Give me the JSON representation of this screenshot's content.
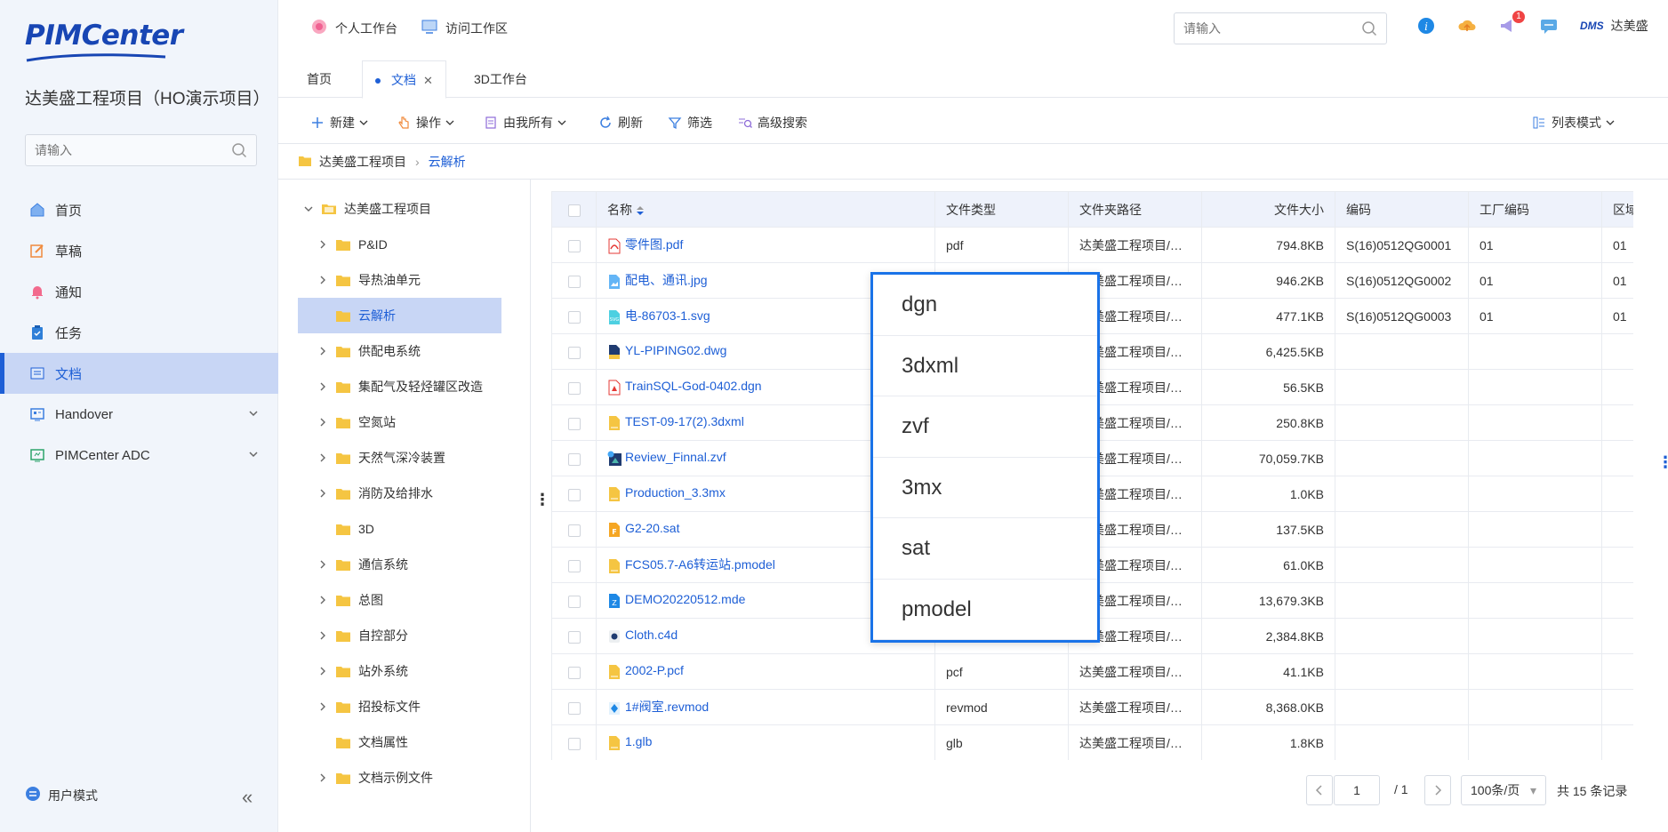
{
  "app": {
    "logo": "PIMCenter",
    "project_title": "达美盛工程项目（HO演示项目）"
  },
  "sidebar": {
    "search_placeholder": "请输入",
    "items": [
      {
        "label": "首页",
        "icon": "home-icon"
      },
      {
        "label": "草稿",
        "icon": "edit-icon"
      },
      {
        "label": "通知",
        "icon": "bell-icon"
      },
      {
        "label": "任务",
        "icon": "clipboard-icon"
      },
      {
        "label": "文档",
        "icon": "document-icon"
      },
      {
        "label": "Handover",
        "icon": "handover-icon"
      },
      {
        "label": "PIMCenter ADC",
        "icon": "adc-icon"
      }
    ],
    "user_mode": "用户模式"
  },
  "topbar": {
    "personal_workspace": "个人工作台",
    "visit_workspace": "访问工作区",
    "search_placeholder": "请输入",
    "notification_count": "1",
    "dms_label": "DMS",
    "user_name": "达美盛"
  },
  "tabs": [
    "首页",
    "文档",
    "3D工作台"
  ],
  "toolbar": {
    "new": "新建",
    "operate": "操作",
    "owned_by_me": "由我所有",
    "refresh": "刷新",
    "filter": "筛选",
    "advanced_search": "高级搜索",
    "view_mode": "列表模式"
  },
  "breadcrumb": {
    "root": "达美盛工程项目",
    "current": "云解析"
  },
  "tree": {
    "root": "达美盛工程项目",
    "children": [
      {
        "label": "P&ID",
        "expandable": true
      },
      {
        "label": "导热油单元",
        "expandable": true
      },
      {
        "label": "云解析",
        "expandable": false,
        "selected": true
      },
      {
        "label": "供配电系统",
        "expandable": true
      },
      {
        "label": "集配气及轻烃罐区改造",
        "expandable": true
      },
      {
        "label": "空氮站",
        "expandable": true
      },
      {
        "label": "天然气深冷装置",
        "expandable": true
      },
      {
        "label": "消防及给排水",
        "expandable": true
      },
      {
        "label": "3D",
        "expandable": false
      },
      {
        "label": "通信系统",
        "expandable": true
      },
      {
        "label": "总图",
        "expandable": true
      },
      {
        "label": "自控部分",
        "expandable": true
      },
      {
        "label": "站外系统",
        "expandable": true
      },
      {
        "label": "招投标文件",
        "expandable": true
      },
      {
        "label": "文档属性",
        "expandable": false
      },
      {
        "label": "文档示例文件",
        "expandable": true
      }
    ]
  },
  "table": {
    "columns": [
      "名称",
      "文件类型",
      "文件夹路径",
      "文件大小",
      "编码",
      "工厂编码",
      "区域"
    ],
    "rows": [
      {
        "name": "零件图.pdf",
        "type": "pdf",
        "path": "达美盛工程项目/云解析",
        "size": "794.8KB",
        "code": "S(16)0512QG0001",
        "plant": "01",
        "area": "01",
        "icon": "pdf"
      },
      {
        "name": "配电、通讯.jpg",
        "type": "",
        "path": "达美盛工程项目/云解析",
        "size": "946.2KB",
        "code": "S(16)0512QG0002",
        "plant": "01",
        "area": "01",
        "icon": "image"
      },
      {
        "name": "电-86703-1.svg",
        "type": "",
        "path": "达美盛工程项目/云解析",
        "size": "477.1KB",
        "code": "S(16)0512QG0003",
        "plant": "01",
        "area": "01",
        "icon": "svg"
      },
      {
        "name": "YL-PIPING02.dwg",
        "type": "",
        "path": "达美盛工程项目/云解析",
        "size": "6,425.5KB",
        "code": "",
        "plant": "",
        "area": "",
        "icon": "dwg"
      },
      {
        "name": "TrainSQL-God-0402.dgn",
        "type": "",
        "path": "达美盛工程项目/云解析",
        "size": "56.5KB",
        "code": "",
        "plant": "",
        "area": "",
        "icon": "dgn"
      },
      {
        "name": "TEST-09-17(2).3dxml",
        "type": "",
        "path": "达美盛工程项目/云解析",
        "size": "250.8KB",
        "code": "",
        "plant": "",
        "area": "",
        "icon": "file"
      },
      {
        "name": "Review_Finnal.zvf",
        "type": "",
        "path": "达美盛工程项目/云解析",
        "size": "70,059.7KB",
        "code": "",
        "plant": "",
        "area": "",
        "icon": "zvf"
      },
      {
        "name": "Production_3.3mx",
        "type": "",
        "path": "达美盛工程项目/云解析",
        "size": "1.0KB",
        "code": "",
        "plant": "",
        "area": "",
        "icon": "file"
      },
      {
        "name": "G2-20.sat",
        "type": "",
        "path": "达美盛工程项目/云解析",
        "size": "137.5KB",
        "code": "",
        "plant": "",
        "area": "",
        "icon": "sat"
      },
      {
        "name": "FCS05.7-A6转运站.pmodel",
        "type": "",
        "path": "达美盛工程项目/云解析",
        "size": "61.0KB",
        "code": "",
        "plant": "",
        "area": "",
        "icon": "file"
      },
      {
        "name": "DEMO20220512.mde",
        "type": "",
        "path": "达美盛工程项目/云解析",
        "size": "13,679.3KB",
        "code": "",
        "plant": "",
        "area": "",
        "icon": "mde"
      },
      {
        "name": "Cloth.c4d",
        "type": "",
        "path": "达美盛工程项目/云解析",
        "size": "2,384.8KB",
        "code": "",
        "plant": "",
        "area": "",
        "icon": "c4d"
      },
      {
        "name": "2002-P.pcf",
        "type": "pcf",
        "path": "达美盛工程项目/云解析",
        "size": "41.1KB",
        "code": "",
        "plant": "",
        "area": "",
        "icon": "file"
      },
      {
        "name": "1#阀室.revmod",
        "type": "revmod",
        "path": "达美盛工程项目/云解析",
        "size": "8,368.0KB",
        "code": "",
        "plant": "",
        "area": "",
        "icon": "revmod"
      },
      {
        "name": "1.glb",
        "type": "glb",
        "path": "达美盛工程项目/云解析",
        "size": "1.8KB",
        "code": "",
        "plant": "",
        "area": "",
        "icon": "file"
      }
    ]
  },
  "popup": {
    "options": [
      "dgn",
      "3dxml",
      "zvf",
      "3mx",
      "sat",
      "pmodel"
    ]
  },
  "pagination": {
    "current_page": "1",
    "total_pages": "/ 1",
    "page_size": "100条/页",
    "total_records": "共 15 条记录"
  },
  "colors": {
    "accent": "#1e5fd6",
    "selected_bg": "#c8d6f5",
    "sidebar_bg": "#f1f5fb",
    "popup_border": "#1a73e8"
  }
}
